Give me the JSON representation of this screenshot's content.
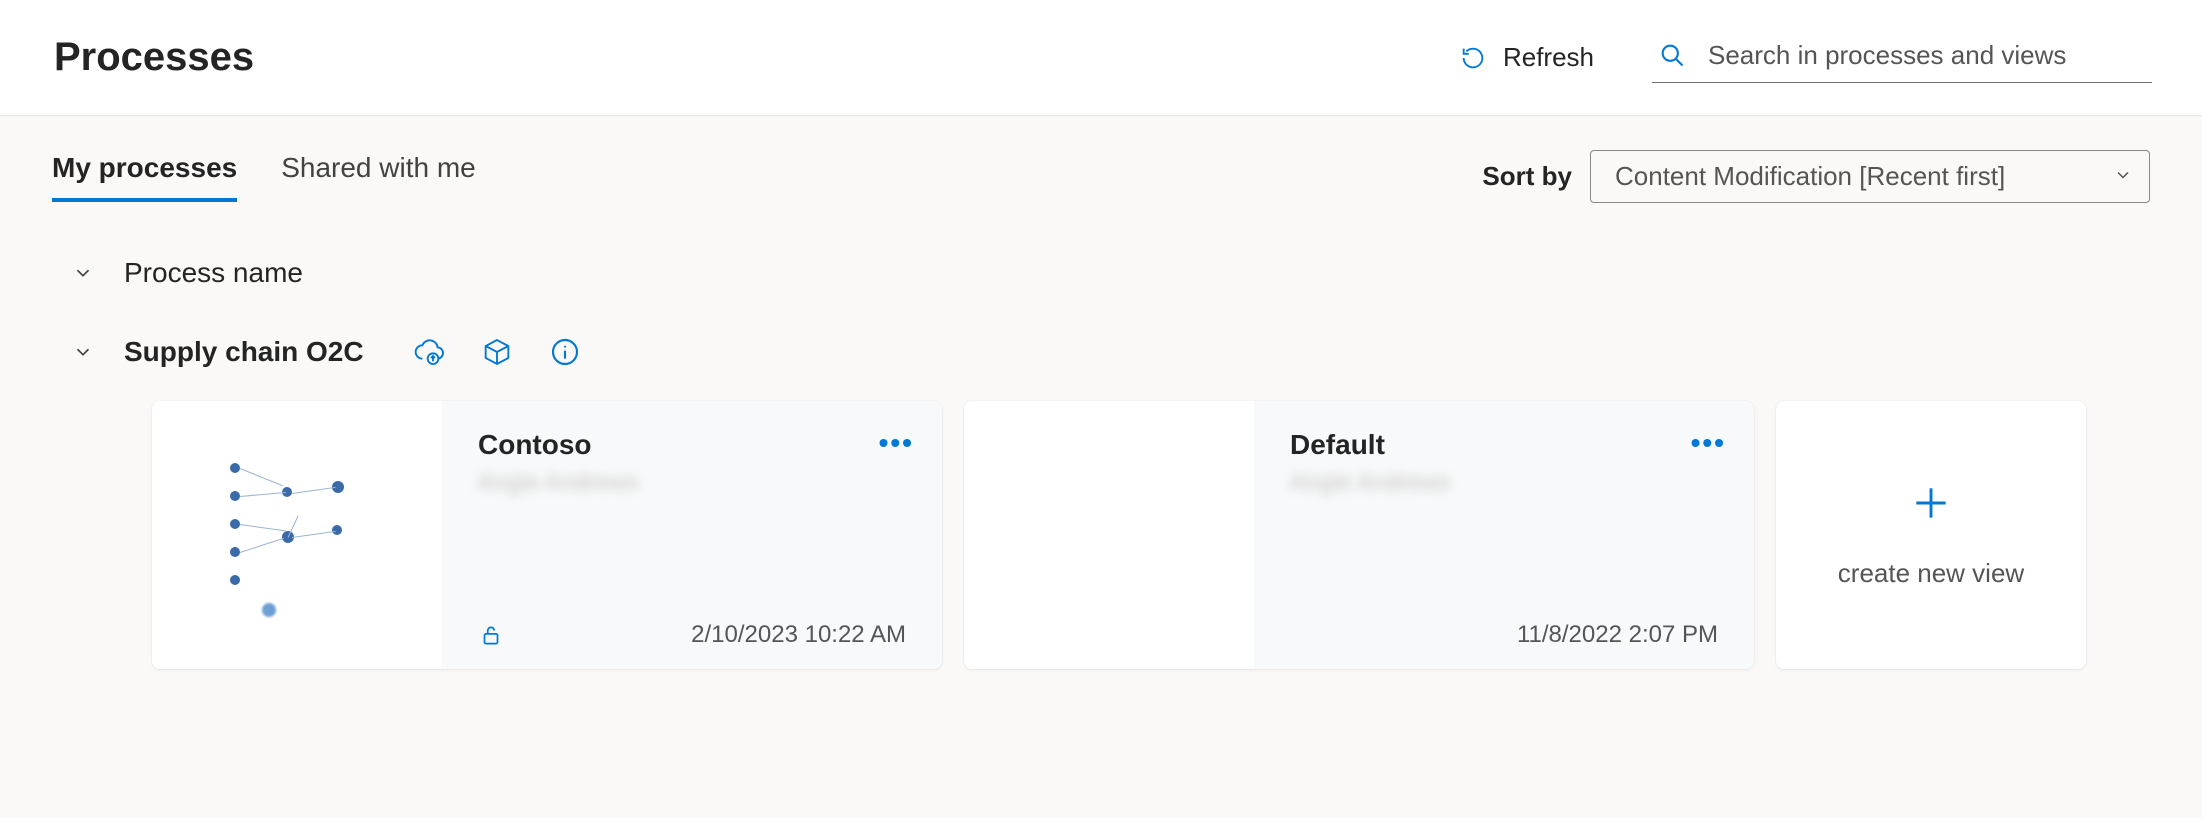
{
  "header": {
    "title": "Processes",
    "refresh_label": "Refresh",
    "search_placeholder": "Search in processes and views"
  },
  "tabs": {
    "my_processes": "My processes",
    "shared_with_me": "Shared with me"
  },
  "sort": {
    "label": "Sort by",
    "selected": "Content Modification [Recent first]"
  },
  "group_header": {
    "label": "Process name"
  },
  "process": {
    "name": "Supply chain O2C"
  },
  "cards": [
    {
      "title": "Contoso",
      "author": "Angie Andrews",
      "timestamp": "2/10/2023 10:22 AM",
      "locked": true
    },
    {
      "title": "Default",
      "author": "Angie Andrews",
      "timestamp": "11/8/2022 2:07 PM",
      "locked": false
    }
  ],
  "new_view": {
    "label": "create new view"
  },
  "colors": {
    "accent": "#0078d4"
  }
}
